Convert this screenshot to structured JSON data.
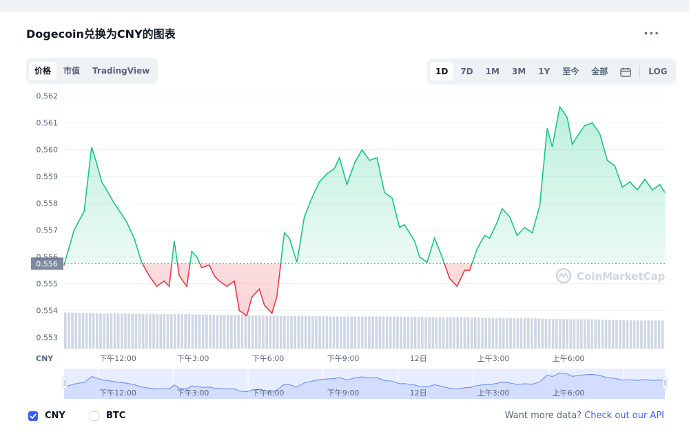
{
  "header": {
    "title": "Dogecoin兑换为CNY的图表",
    "more_label": "..."
  },
  "type_tabs": [
    {
      "label": "价格",
      "active": true
    },
    {
      "label": "市值",
      "active": false
    },
    {
      "label": "TradingView",
      "active": false
    }
  ],
  "range_tabs": [
    {
      "label": "1D",
      "active": true
    },
    {
      "label": "7D",
      "active": false
    },
    {
      "label": "1M",
      "active": false
    },
    {
      "label": "3M",
      "active": false
    },
    {
      "label": "1Y",
      "active": false
    },
    {
      "label": "至今",
      "active": false
    },
    {
      "label": "全部",
      "active": false
    }
  ],
  "log_label": "LOG",
  "calendar_icon": "calendar-icon",
  "colors": {
    "up": "#16c784",
    "down": "#ea3943",
    "accent": "#3861fb",
    "volume": "#cfd6e4",
    "nav": "#6188ff"
  },
  "chart_data": {
    "type": "line",
    "currency_label": "CNY",
    "baseline": 0.55575,
    "baseline_label": "0.556",
    "ylim": [
      0.5525,
      0.5623
    ],
    "yticks": [
      0.553,
      0.554,
      0.555,
      0.556,
      0.557,
      0.558,
      0.559,
      0.56,
      0.561,
      0.562
    ],
    "ytick_labels": [
      "0.553",
      "0.554",
      "0.555",
      "0.556",
      "0.557",
      "0.558",
      "0.559",
      "0.560",
      "0.561",
      "0.562"
    ],
    "xlim": [
      0,
      24
    ],
    "xticks": [
      {
        "x": 2.15,
        "label": "下午12:00"
      },
      {
        "x": 5.15,
        "label": "下午3:00"
      },
      {
        "x": 8.15,
        "label": "下午6:00"
      },
      {
        "x": 11.15,
        "label": "下午9:00"
      },
      {
        "x": 14.15,
        "label": "12日"
      },
      {
        "x": 17.15,
        "label": "上午3:00"
      },
      {
        "x": 20.15,
        "label": "上午6:00"
      }
    ],
    "x": [
      0,
      0.4,
      0.8,
      1.1,
      1.3,
      1.5,
      1.7,
      2.0,
      2.3,
      2.5,
      2.8,
      3.1,
      3.4,
      3.7,
      4.0,
      4.2,
      4.4,
      4.6,
      4.9,
      5.1,
      5.3,
      5.5,
      5.8,
      6.0,
      6.2,
      6.5,
      6.8,
      7.0,
      7.3,
      7.5,
      7.8,
      8.0,
      8.3,
      8.5,
      8.8,
      9.0,
      9.3,
      9.6,
      9.9,
      10.2,
      10.5,
      10.8,
      11.0,
      11.3,
      11.6,
      11.9,
      12.2,
      12.5,
      12.8,
      13.1,
      13.4,
      13.6,
      14.0,
      14.2,
      14.5,
      14.8,
      15.1,
      15.4,
      15.7,
      16.0,
      16.2,
      16.5,
      16.8,
      17.0,
      17.3,
      17.5,
      17.8,
      18.1,
      18.4,
      18.7,
      19.0,
      19.3,
      19.5,
      19.8,
      20.1,
      20.3,
      20.5,
      20.8,
      21.1,
      21.4,
      21.7,
      22.0,
      22.3,
      22.6,
      22.9,
      23.2,
      23.5,
      23.8,
      24.0
    ],
    "y": [
      0.5557,
      0.557,
      0.5577,
      0.5601,
      0.5595,
      0.5588,
      0.5585,
      0.558,
      0.5576,
      0.5573,
      0.5567,
      0.5558,
      0.5553,
      0.5549,
      0.5551,
      0.5549,
      0.5566,
      0.5553,
      0.5549,
      0.5562,
      0.556,
      0.5556,
      0.5557,
      0.5553,
      0.5551,
      0.5549,
      0.5551,
      0.554,
      0.5538,
      0.5545,
      0.5548,
      0.5542,
      0.5539,
      0.5545,
      0.5569,
      0.5567,
      0.5558,
      0.5575,
      0.5582,
      0.5588,
      0.5591,
      0.5593,
      0.5597,
      0.5587,
      0.5595,
      0.56,
      0.5596,
      0.5597,
      0.5584,
      0.5582,
      0.5571,
      0.5572,
      0.5566,
      0.556,
      0.5558,
      0.5567,
      0.556,
      0.5552,
      0.5549,
      0.5555,
      0.5555,
      0.5563,
      0.5568,
      0.5567,
      0.5573,
      0.5578,
      0.5575,
      0.5568,
      0.5571,
      0.5569,
      0.5579,
      0.5608,
      0.5601,
      0.5616,
      0.5612,
      0.5602,
      0.5605,
      0.5609,
      0.561,
      0.5606,
      0.5596,
      0.5594,
      0.5586,
      0.5588,
      0.5585,
      0.5589,
      0.5585,
      0.5587,
      0.5584
    ],
    "volume": [
      0.92,
      0.91,
      0.9,
      0.9,
      0.89,
      0.88,
      0.88,
      0.87,
      0.86,
      0.86,
      0.85,
      0.84,
      0.84,
      0.83,
      0.82,
      0.82,
      0.82,
      0.82,
      0.81,
      0.8,
      0.8,
      0.8,
      0.79,
      0.78,
      0.78,
      0.76,
      0.75,
      0.75,
      0.74,
      0.73,
      0.72,
      0.72
    ],
    "watermark": "CoinMarketCap"
  },
  "navigator": {
    "labels": [
      "下午12:00",
      "下午3:00",
      "下午6:00",
      "下午9:00",
      "12日",
      "上午3:00",
      "上午6:00"
    ]
  },
  "footer": {
    "currencies": [
      {
        "label": "CNY",
        "checked": true
      },
      {
        "label": "BTC",
        "checked": false
      }
    ],
    "want_text": "Want more data?",
    "api_link": "Check out our API"
  }
}
